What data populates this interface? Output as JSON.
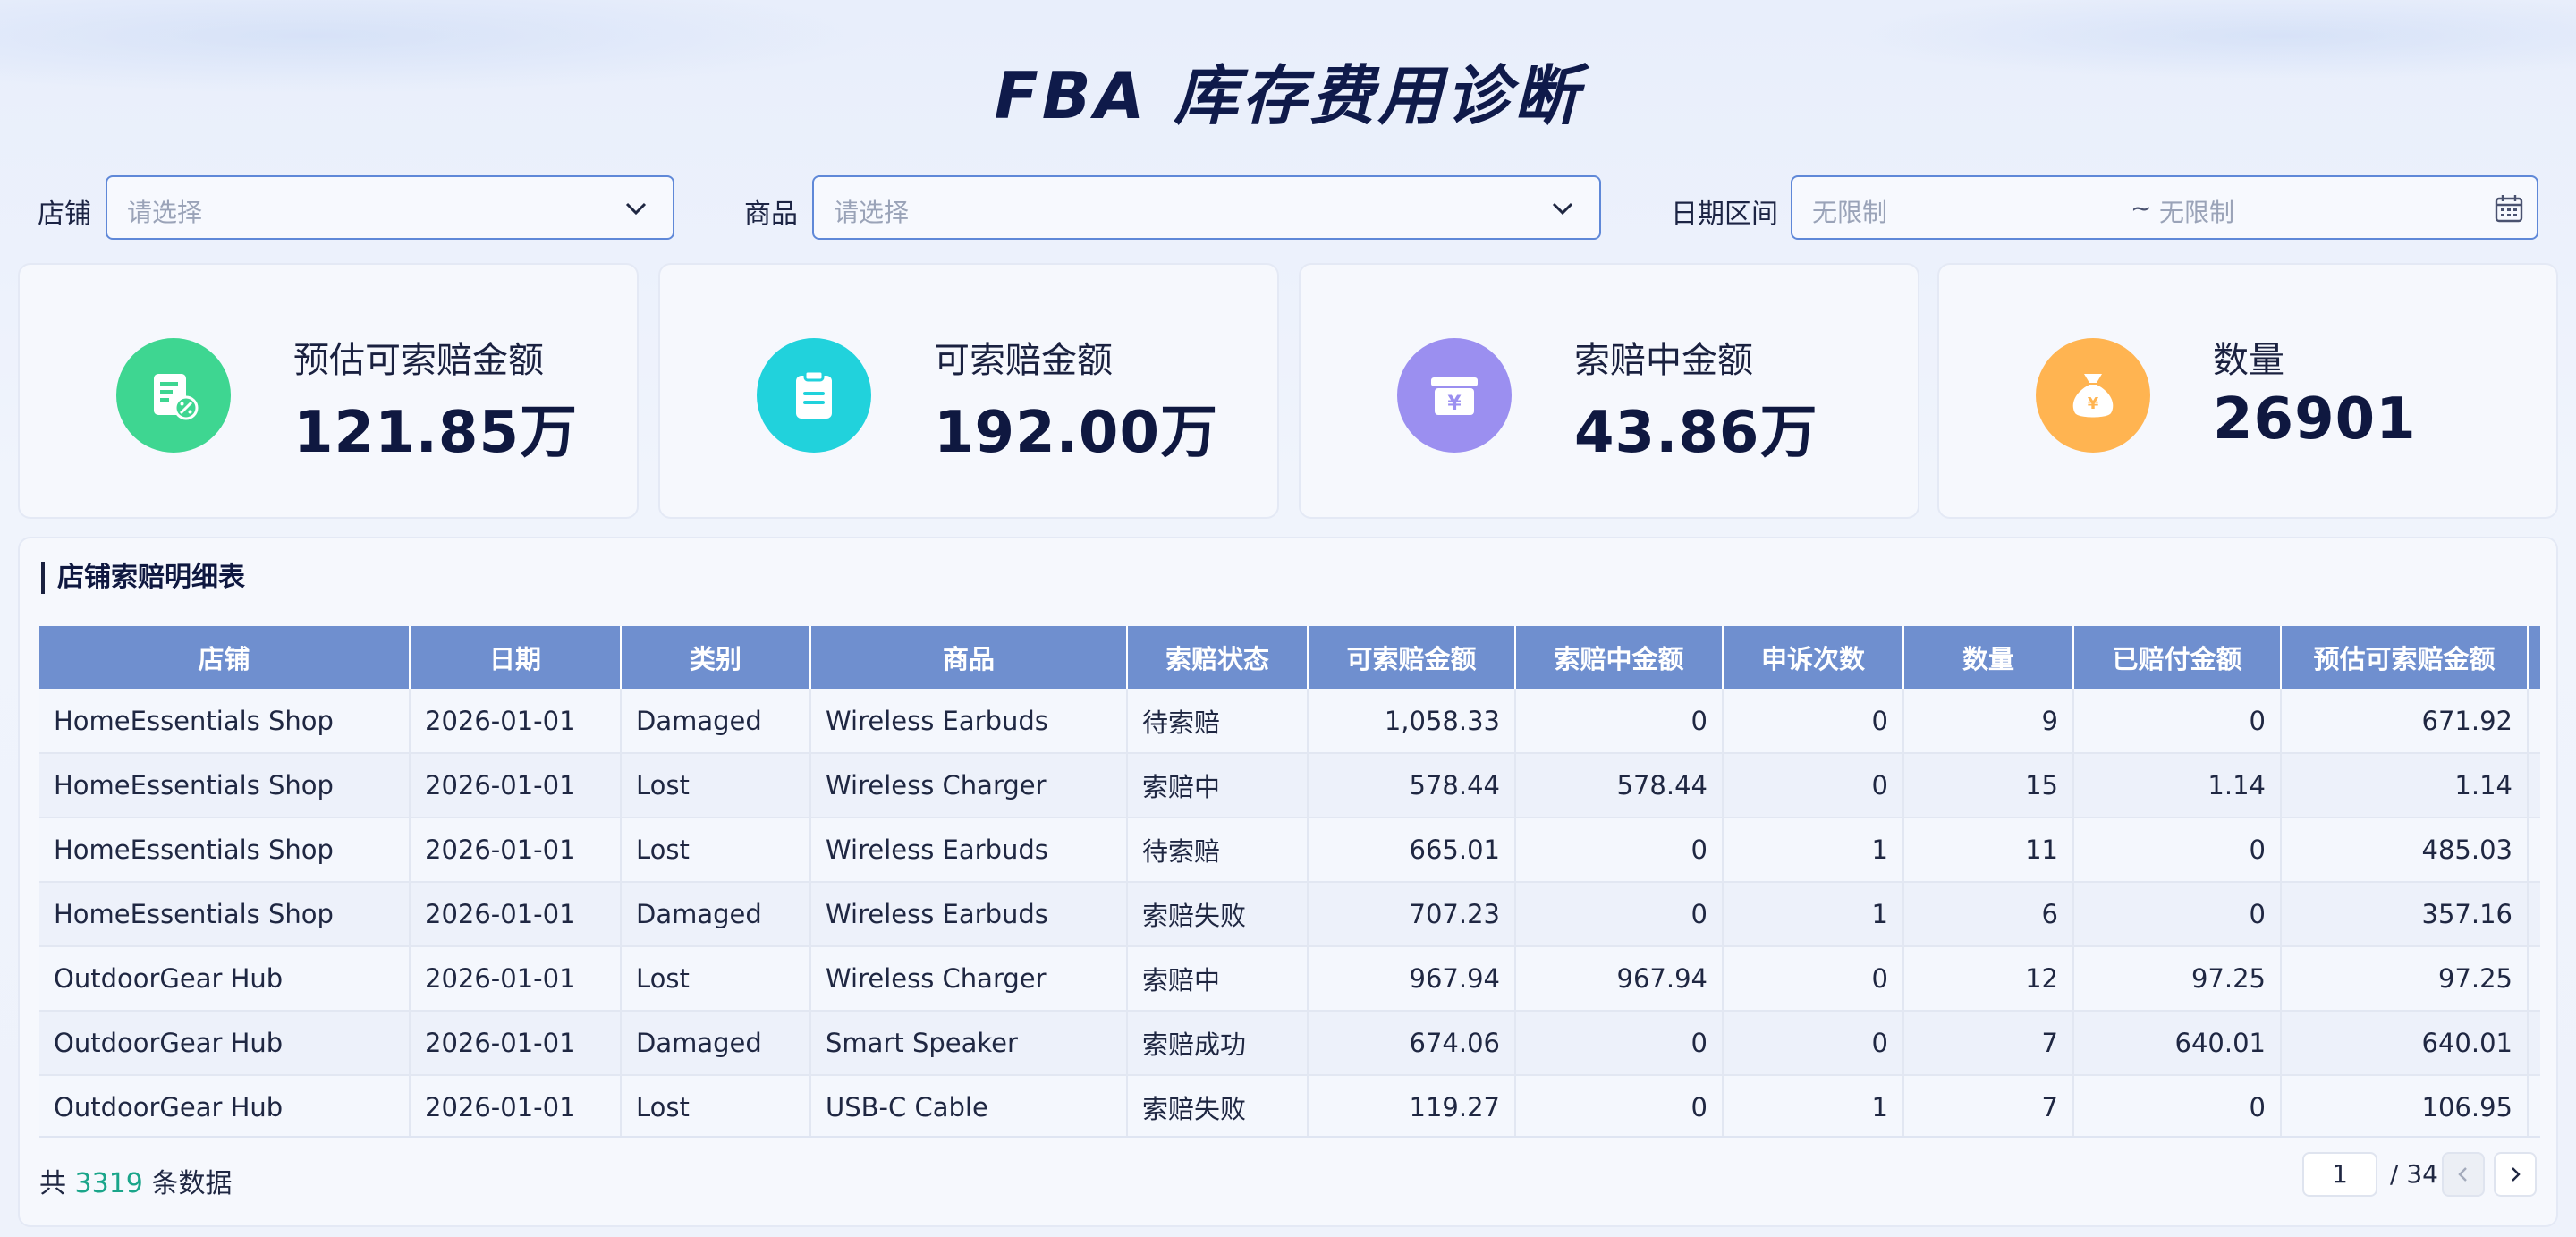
{
  "title": "FBA 库存费用诊断",
  "filters": {
    "shop": {
      "label": "店铺",
      "placeholder": "请选择"
    },
    "product": {
      "label": "商品",
      "placeholder": "请选择"
    },
    "date": {
      "label": "日期区间",
      "start_placeholder": "无限制",
      "separator": "~",
      "end_placeholder": "无限制"
    }
  },
  "kpis": [
    {
      "label": "预估可索赔金额",
      "value": "121.85万",
      "icon": "document-percent-icon",
      "color": "#3ed691"
    },
    {
      "label": "可索赔金额",
      "value": "192.00万",
      "icon": "clipboard-icon",
      "color": "#21d2dc"
    },
    {
      "label": "索赔中金额",
      "value": "43.86万",
      "icon": "yuan-wallet-icon",
      "color": "#9b8ff0"
    },
    {
      "label": "数量",
      "value": "26901",
      "icon": "money-bag-icon",
      "color": "#ffb451"
    }
  ],
  "table": {
    "title": "店铺索赔明细表",
    "columns": [
      "店铺",
      "日期",
      "类别",
      "商品",
      "索赔状态",
      "可索赔金额",
      "索赔中金额",
      "申诉次数",
      "数量",
      "已赔付金额",
      "预估可索赔金额"
    ],
    "rows": [
      [
        "HomeEssentials Shop",
        "2026-01-01",
        "Damaged",
        "Wireless Earbuds",
        "待索赔",
        "1,058.33",
        "0",
        "0",
        "9",
        "0",
        "671.92"
      ],
      [
        "HomeEssentials Shop",
        "2026-01-01",
        "Lost",
        "Wireless Charger",
        "索赔中",
        "578.44",
        "578.44",
        "0",
        "15",
        "1.14",
        "1.14"
      ],
      [
        "HomeEssentials Shop",
        "2026-01-01",
        "Lost",
        "Wireless Earbuds",
        "待索赔",
        "665.01",
        "0",
        "1",
        "11",
        "0",
        "485.03"
      ],
      [
        "HomeEssentials Shop",
        "2026-01-01",
        "Damaged",
        "Wireless Earbuds",
        "索赔失败",
        "707.23",
        "0",
        "1",
        "6",
        "0",
        "357.16"
      ],
      [
        "OutdoorGear Hub",
        "2026-01-01",
        "Lost",
        "Wireless Charger",
        "索赔中",
        "967.94",
        "967.94",
        "0",
        "12",
        "97.25",
        "97.25"
      ],
      [
        "OutdoorGear Hub",
        "2026-01-01",
        "Damaged",
        "Smart Speaker",
        "索赔成功",
        "674.06",
        "0",
        "0",
        "7",
        "640.01",
        "640.01"
      ],
      [
        "OutdoorGear Hub",
        "2026-01-01",
        "Lost",
        "USB-C Cable",
        "索赔失败",
        "119.27",
        "0",
        "1",
        "7",
        "0",
        "106.95"
      ]
    ]
  },
  "footer": {
    "prefix": "共",
    "count": "3319",
    "suffix": "条数据",
    "page": "1",
    "total_pages": "/ 34"
  }
}
